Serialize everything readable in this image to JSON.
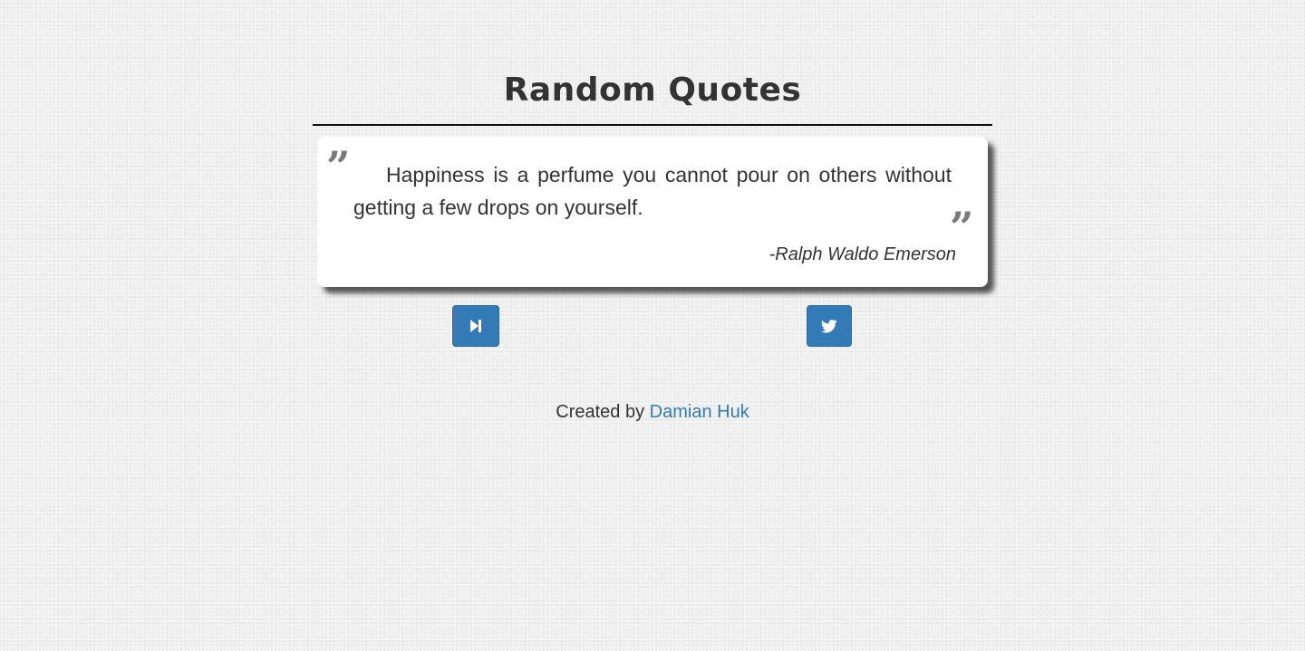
{
  "header": {
    "title": "Random Quotes"
  },
  "quote": {
    "open_mark": "”",
    "close_mark": "”",
    "text": "Happiness is a perfume you cannot pour on others without getting a few drops on yourself.",
    "author": "-Ralph Waldo Emerson"
  },
  "actions": {
    "next_icon": "step-forward-icon",
    "tweet_icon": "twitter-icon"
  },
  "footer": {
    "prefix": "Created by",
    "author_link": "Damian Huk"
  },
  "colors": {
    "background": "#efefef",
    "button": "#337ab7",
    "link": "#337ab7",
    "text": "#333333",
    "quote_mark": "#7a7a7a"
  }
}
